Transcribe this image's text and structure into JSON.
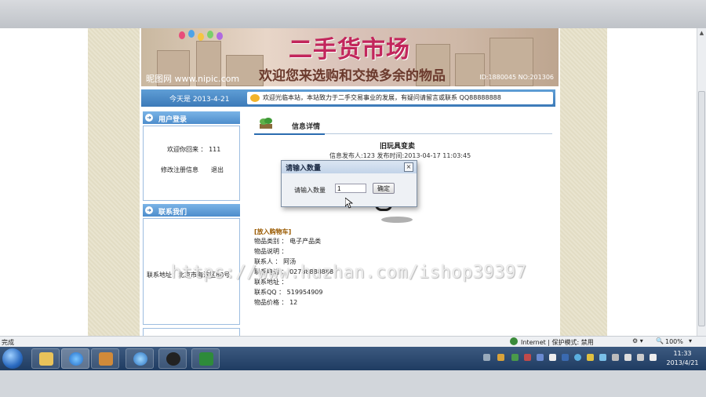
{
  "banner": {
    "title": "二手货市场",
    "subtitle": "欢迎您来选购和交换多余的物品",
    "url_text": "昵图网 www.nipic.com",
    "right_text": "ID:1880045 NO:201306"
  },
  "bar": {
    "date": "今天是 2013-4-21",
    "marquee": "欢迎光临本站，本站致力于二手交易事业的发展，有疑问请留言或联系 QQ88888888"
  },
  "login": {
    "header": "用户登录",
    "welcome": "欢迎你回来 ： 111",
    "edit_link": "修改注册信息",
    "logout_link": "退出"
  },
  "contact": {
    "header": "联系我们",
    "address": "联系地址：北京市海淀区88号"
  },
  "detail": {
    "header": "信息详情",
    "item_title": "旧玩具变卖",
    "meta": "信息发布人:123   发布时间:2013-04-17 11:03:45",
    "add_to_cart": "[放入购物车]",
    "fields": [
      "物品类别 ： 电子产品类",
      "物品说明 ：",
      "联系人 ： 阿汤",
      "联系电话 ： 02788888888",
      "联系地址 ：",
      "联系QQ ： 519954909",
      "物品价格 ： 12"
    ]
  },
  "dialog": {
    "title": "请输入数量",
    "close": "×",
    "label": "请输入数量",
    "input_value": "1",
    "confirm": "确定"
  },
  "watermark": "https://www.huzhan.com/ishop39397",
  "status": {
    "left": "完成",
    "zone": "Internet | 保护模式: 禁用",
    "zoom": "100%"
  },
  "clock": {
    "time": "11:33",
    "date": "2013/4/21"
  },
  "colors": {
    "blue_bar": "#3c7ab8",
    "title_red": "#c2265c",
    "taskbar": "#1f3c62"
  }
}
